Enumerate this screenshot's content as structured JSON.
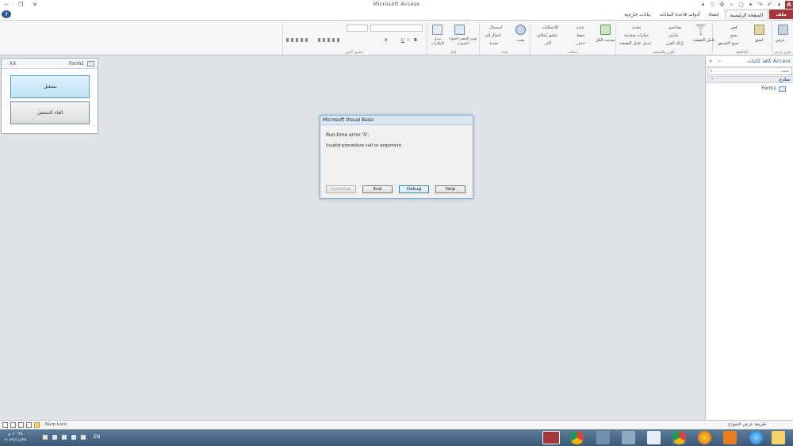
{
  "window": {
    "title": "Microsoft Access",
    "minimize_glyph": "−",
    "restore_glyph": "❐",
    "close_glyph": "✕",
    "help_glyph": "?"
  },
  "qat": [
    "A",
    "▾",
    "↶",
    "↷",
    "▾",
    "▢",
    "⌕",
    "⚙",
    "▽",
    "▾"
  ],
  "tabs": {
    "file": "ملف",
    "home": "الصفحة الرئيسية",
    "create": "إنشاء",
    "database_tools": "أدوات قاعدة البيانات",
    "external_data": "بيانات خارجية"
  },
  "ribbon": {
    "views": {
      "view": "عرض",
      "label": "طرق عرض"
    },
    "clipboard": {
      "paste": "لصق",
      "cut": "قص",
      "copy": "نسخ",
      "format_painter": "نسخ التنسيق",
      "label": "الحافظة"
    },
    "sort_filter": {
      "filter": "عامل التصفية",
      "ascending": "تصاعدي",
      "descending": "تنازلي",
      "remove_sort": "إزالة الفرز",
      "selection": "تحديد",
      "advanced": "خيارات متقدمة",
      "toggle_filter": "تبديل عامل التصفية",
      "label": "الفرز والتصفية"
    },
    "records": {
      "refresh_all": "تحديث الكل",
      "new": "جديد",
      "save": "حفظ",
      "delete": "حذف",
      "totals": "الإجماليات",
      "spelling": "تدقيق إملائي",
      "more": "أكثر",
      "label": "سجلات"
    },
    "find": {
      "find": "بحث",
      "replace": "استبدال",
      "go_to": "انتقال إلى",
      "select": "تحديد",
      "label": "بحث"
    },
    "window": {
      "fit_form": "تغيير الحجم لاحتواء النموذج",
      "switch_windows": "تبديل الإطارات",
      "label": "إطار"
    },
    "text_formatting": {
      "label": "تنسيق النص",
      "bold": "B",
      "italic": "I",
      "underline": "U",
      "font_color": "A"
    }
  },
  "nav_pane": {
    "title": "كافة كائنات Access",
    "search_placeholder": "...بحث",
    "group": "نماذج",
    "item": "Form1"
  },
  "form_window": {
    "title": "Form1",
    "close": "XX",
    "run_button": "تشغيل",
    "cancel_button": "الغاء التشغيل"
  },
  "dialog": {
    "title": "Microsoft Visual Basic",
    "message1": "Run-time error '5':",
    "message2": "Invalid procedure call or argument",
    "buttons": {
      "continue": "Continue",
      "end": "End",
      "debug": "Debug",
      "help": "Help"
    }
  },
  "statusbar": {
    "view": "طريقة عرض النموذج",
    "num_lock": "Num Lock"
  },
  "taskbar": {
    "time": "١٠:٣٤ م",
    "date": "٢٠٢٢/١١/٢٩",
    "language": "EN"
  },
  "colors": {
    "file_tab": "#a4373a",
    "accent": "#2b579a",
    "taskbar": "#3d5a78"
  }
}
